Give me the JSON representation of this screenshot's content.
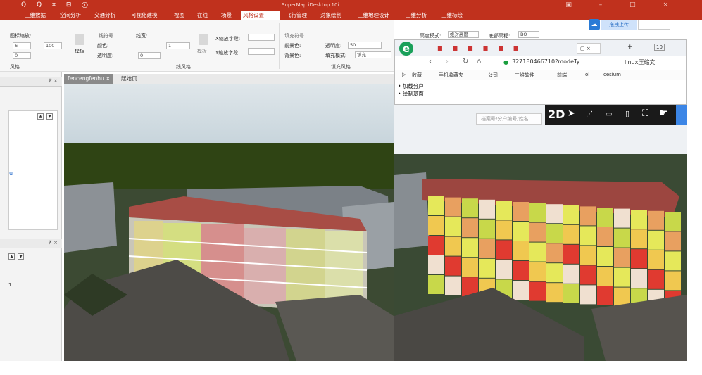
{
  "titlebar": {
    "title": "SuperMap iDesktop 10i",
    "quick_access": "Q Q ⌗ ⊟ ⓘ",
    "window_controls": "▣ – □ ×"
  },
  "menu": [
    "三维数据",
    "空间分析",
    "交通分析",
    "可视化建模",
    "视图",
    "在线",
    "场景",
    "风格设置",
    "飞行管理",
    "对象绘制",
    "三维地理设计",
    "三维分析",
    "三维标绘"
  ],
  "ribbon": {
    "icon_scale_label": "图标缩放:",
    "icon_val1": "6",
    "icon_val2": "100",
    "icon_val3": "0",
    "group1": "风格",
    "template_label": "模板",
    "line_symbol": "线符号",
    "line_width": "线宽:",
    "color": "颜色:",
    "transparency": "透明度:",
    "trans_val": "0",
    "width_val": "1",
    "group2": "线风格",
    "x_scale": "X缩放字段:",
    "y_scale": "Y缩放字段:",
    "fill_symbol": "填充符号",
    "fore_color": "前景色:",
    "back_color": "背景色:",
    "trans2": "透明度:",
    "trans2_val": "50",
    "fill_mode": "填充模式:",
    "fill_mode_val": "填充",
    "group3": "填充风格",
    "extra1": "高度模式:",
    "extra1_val": "绝对高度",
    "extra2": "底部高程:",
    "extra2_val": "BO"
  },
  "docs": {
    "tab1": "fencengfenhu",
    "tab2": "起始页"
  },
  "browser": {
    "address": "327180466710?modeTy",
    "ext": "linux压缩文",
    "bookmarks": [
      "收藏",
      "手机收藏夹",
      "公司",
      "三维软件",
      "前端",
      "ol",
      "cesium"
    ],
    "list": [
      "加载分户",
      "绘制基面"
    ],
    "search_placeholder": "档案号/分户编号/姓名",
    "toolbar": {
      "mode": "2D"
    }
  },
  "upload": {
    "label": "拖拽上传"
  },
  "left": {
    "label1": "u",
    "label2": "1"
  }
}
